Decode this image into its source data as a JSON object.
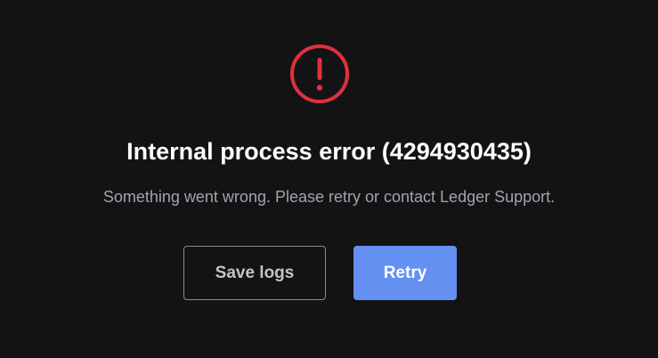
{
  "dialog": {
    "icon": "exclamation-circle-icon",
    "title": "Internal process error (4294930435)",
    "message": "Something went wrong. Please retry or contact Ledger Support.",
    "save_logs_label": "Save logs",
    "retry_label": "Retry"
  },
  "colors": {
    "background": "#131316",
    "error_red": "#e0303e",
    "primary": "#6490f1",
    "title_text": "#ffffff",
    "message_text": "#a3a3a8"
  }
}
